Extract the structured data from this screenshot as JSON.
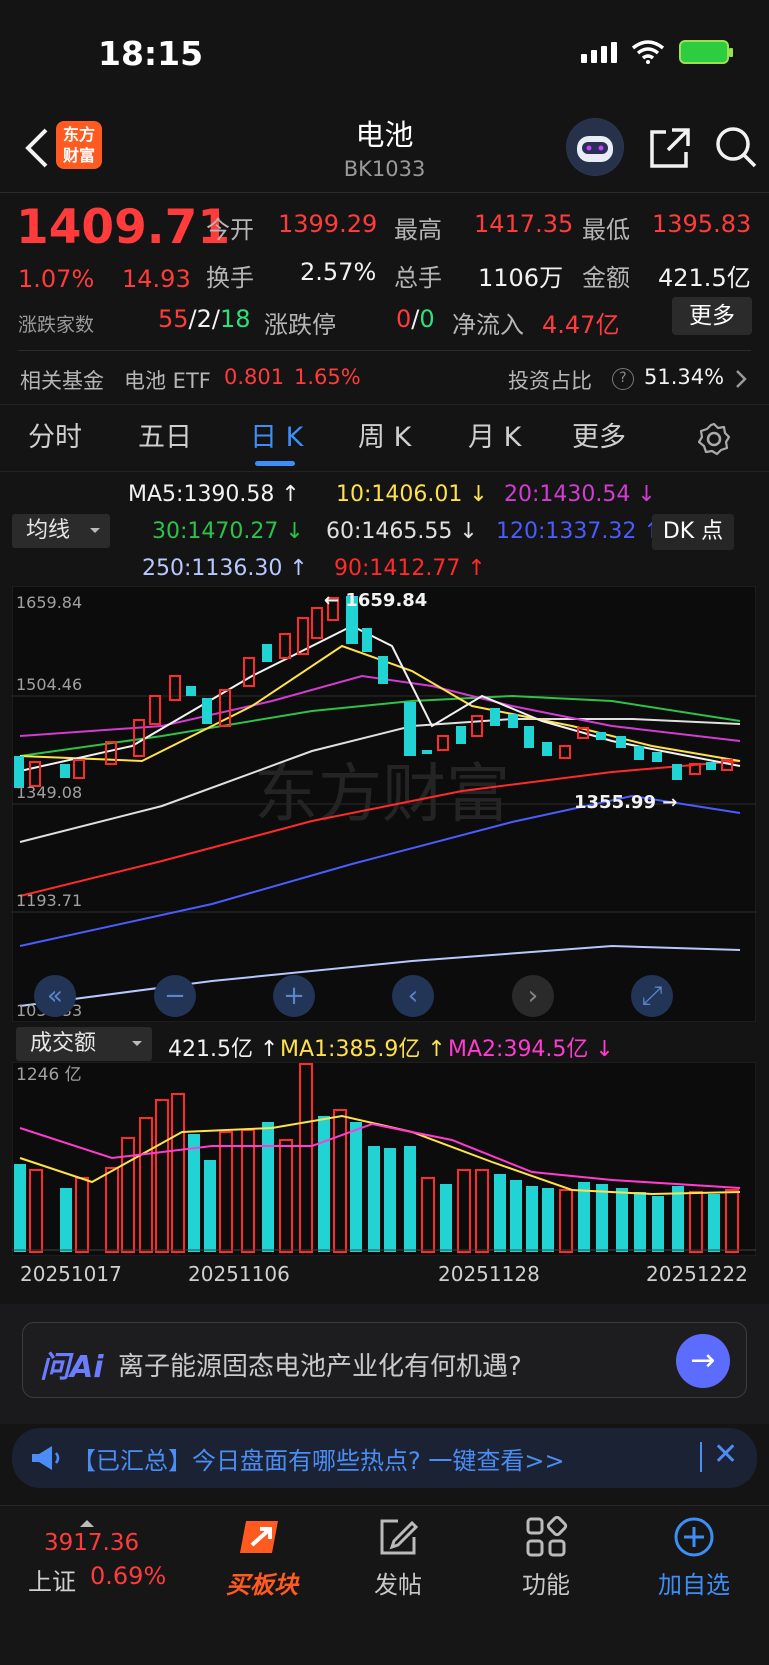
{
  "status_bar": {
    "time": "18:15"
  },
  "header": {
    "title": "电池",
    "code": "BK1033",
    "logo_line1": "东方",
    "logo_line2": "财富"
  },
  "quote": {
    "price": "1409.71",
    "change_pct": "1.07%",
    "change_abs": "14.93",
    "open_label": "今开",
    "open": "1399.29",
    "high_label": "最高",
    "high": "1417.35",
    "low_label": "最低",
    "low": "1395.83",
    "turnover_label": "换手",
    "turnover": "2.57%",
    "volume_label": "总手",
    "volume": "1106万",
    "amount_label": "金额",
    "amount": "421.5亿",
    "updown_label": "涨跌家数",
    "up_count": "55",
    "flat_count": "2",
    "down_count": "18",
    "sep": "/",
    "limit_label": "涨跌停",
    "limit_up": "0",
    "limit_down": "0",
    "netflow_label": "净流入",
    "netflow": "4.47亿",
    "more_label": "更多"
  },
  "fund": {
    "label": "相关基金",
    "name": "电池 ETF",
    "price": "0.801",
    "change": "1.65%",
    "ratio_label": "投资占比",
    "ratio": "51.34%"
  },
  "tabs": [
    {
      "label": "分时"
    },
    {
      "label": "五日"
    },
    {
      "label": "日 K"
    },
    {
      "label": "周 K"
    },
    {
      "label": "月 K"
    },
    {
      "label": "更多"
    }
  ],
  "ma_panel": {
    "selector": "均线",
    "dk_label": "DK 点",
    "ma5": "MA5:1390.58 ↑",
    "ma10": "10:1406.01 ↓",
    "ma20": "20:1430.54 ↓",
    "ma30": "30:1470.27 ↓",
    "ma60": "60:1465.55 ↓",
    "ma120": "120:1337.32 ↑",
    "ma250": "250:1136.30 ↑",
    "ma90": "90:1412.77 ↑",
    "colors": {
      "ma5": "#f2f2f2",
      "ma10": "#ffe24a",
      "ma20": "#d23cd2",
      "ma30": "#2ec24a",
      "ma60": "#e0e0e0",
      "ma120": "#4a5cff",
      "ma250": "#b8c8ff",
      "ma90": "#ff2a2a"
    }
  },
  "kline": {
    "y_labels": [
      "1659.84",
      "1504.46",
      "1349.08",
      "1193.71",
      "1038.33"
    ],
    "high_mark": "← 1659.84",
    "low_mark": "1355.99 →",
    "watermark": "东方财富"
  },
  "volume_panel": {
    "selector": "成交额",
    "current": "421.5亿 ↑",
    "ma1": "MA1:385.9亿 ↑",
    "ma2": "MA2:394.5亿 ↓",
    "max_label": "1246 亿",
    "dates": [
      "20251017",
      "20251106",
      "20251128",
      "20251222"
    ]
  },
  "ai": {
    "logo": "问Ai",
    "prompt": "离子能源固态电池产业化有何机遇?"
  },
  "notice": {
    "text": "【已汇总】今日盘面有哪些热点? 一键查看>>"
  },
  "bottom_nav": {
    "index_value": "3917.36",
    "index_name": "上证",
    "index_change": "0.69%",
    "items": [
      {
        "label": "买板块"
      },
      {
        "label": "发帖"
      },
      {
        "label": "功能"
      },
      {
        "label": "加自选"
      }
    ]
  }
}
